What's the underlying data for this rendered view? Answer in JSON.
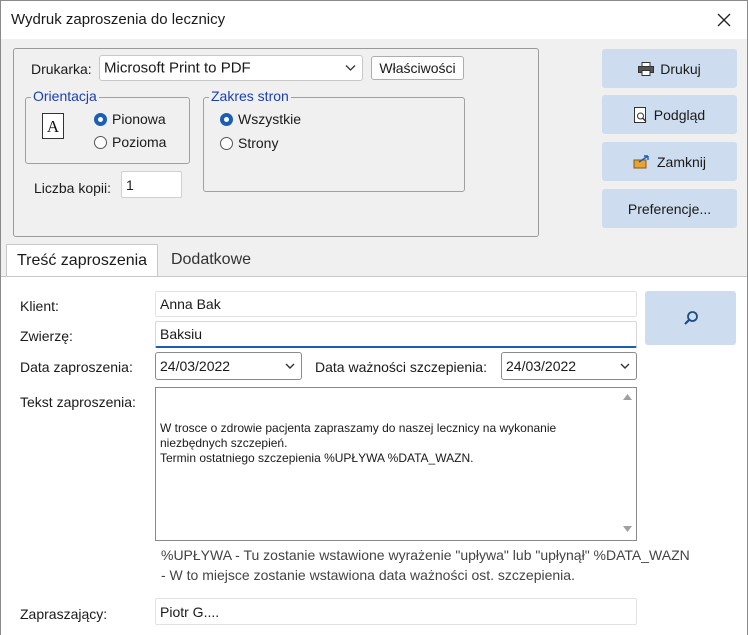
{
  "window": {
    "title": "Wydruk zaproszenia do lecznicy"
  },
  "printer": {
    "label": "Drukarka:",
    "value": "Microsoft Print to PDF",
    "properties_button": "Właściwości"
  },
  "orientation": {
    "legend": "Orientacja",
    "options": [
      "Pionowa",
      "Pozioma"
    ],
    "selected": "Pionowa"
  },
  "page_range": {
    "legend": "Zakres stron",
    "options": [
      "Wszystkie",
      "Strony"
    ],
    "selected": "Wszystkie"
  },
  "copies": {
    "label": "Liczba kopii:",
    "value": "1"
  },
  "actions": {
    "print": "Drukuj",
    "preview": "Podgląd",
    "close": "Zamknij",
    "preferences": "Preferencje..."
  },
  "tabs": [
    "Treść zaproszenia",
    "Dodatkowe"
  ],
  "form": {
    "client_label": "Klient:",
    "client_value": "Anna Bak",
    "pet_label": "Zwierzę:",
    "pet_value": "Baksiu",
    "invite_date_label": "Data zaproszenia:",
    "invite_date_value": "24/03/2022",
    "vacc_date_label": "Data ważności szczepienia:",
    "vacc_date_value": "24/03/2022",
    "text_label": "Tekst zaproszenia:",
    "text_value": "W trosce o zdrowie pacjenta zapraszamy do naszej lecznicy na wykonanie\nniezbędnych szczepień.\nTermin ostatniego szczepienia %UPŁYWA %DATA_WAZN.",
    "hint_line1": "%UPŁYWA - Tu zostanie wstawione wyrażenie \"upływa\" lub \"upłynął\"  %DATA_WAZN",
    "hint_line2": "- W to miejsce zostanie wstawiona data ważności ost. szczepienia.",
    "inviter_label": "Zapraszający:",
    "inviter_value": "Piotr G...."
  },
  "colors": {
    "accent": "#1a5fb4",
    "button_bg": "#cddcee",
    "legend": "#1a3fae"
  }
}
